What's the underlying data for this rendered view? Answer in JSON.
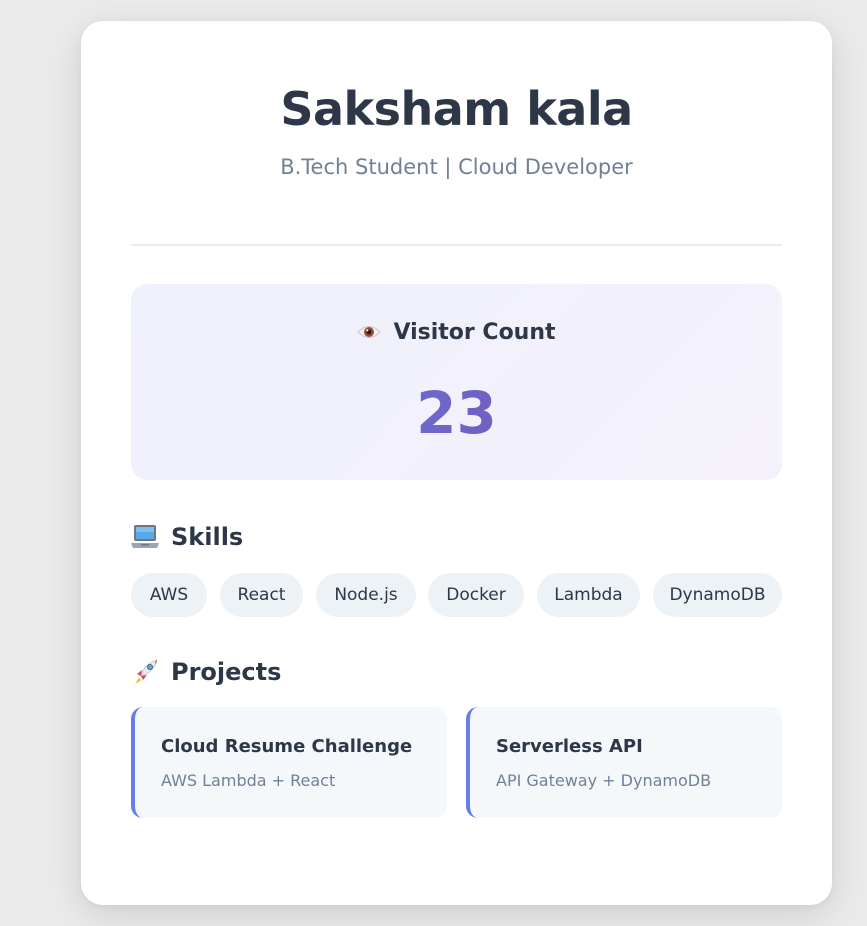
{
  "profile": {
    "name": "Saksham kala",
    "subtitle": "B.Tech Student | Cloud Developer"
  },
  "visitor": {
    "icon": "eye-icon",
    "title": "Visitor Count",
    "count": "23"
  },
  "skills": {
    "icon": "laptop-icon",
    "title": "Skills",
    "items": [
      "AWS",
      "React",
      "Node.js",
      "Docker",
      "Lambda",
      "DynamoDB"
    ]
  },
  "projects": {
    "icon": "rocket-icon",
    "title": "Projects",
    "items": [
      {
        "name": "Cloud Resume Challenge",
        "tech": "AWS Lambda + React"
      },
      {
        "name": "Serverless API",
        "tech": "API Gateway + DynamoDB"
      }
    ]
  },
  "colors": {
    "accent": "#667eea",
    "accent_end": "#764ba2",
    "heading": "#2d3748",
    "muted": "#718096"
  }
}
